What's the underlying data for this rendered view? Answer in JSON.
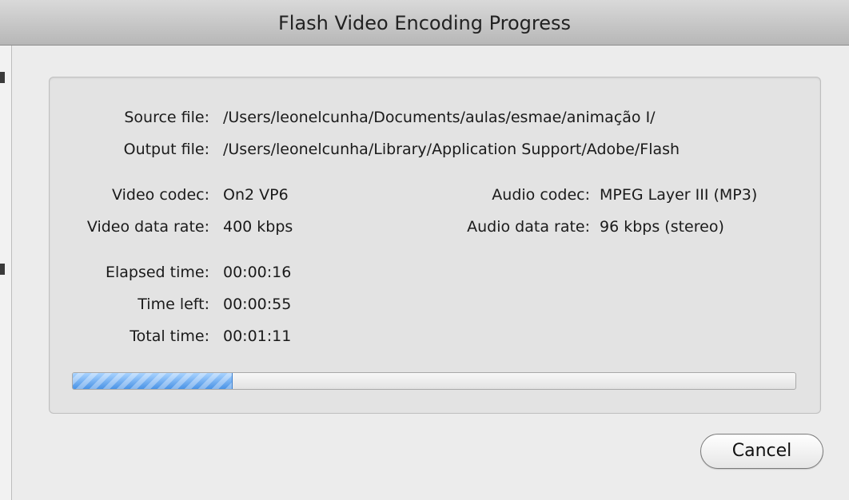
{
  "window": {
    "title": "Flash Video Encoding Progress"
  },
  "details": {
    "source_file": {
      "label": "Source file:",
      "value": "/Users/leonelcunha/Documents/aulas/esmae/animação I/"
    },
    "output_file": {
      "label": "Output file:",
      "value": "/Users/leonelcunha/Library/Application Support/Adobe/Flash"
    },
    "video_codec": {
      "label": "Video codec:",
      "value": "On2 VP6"
    },
    "video_data_rate": {
      "label": "Video data rate:",
      "value": "400 kbps"
    },
    "audio_codec": {
      "label": "Audio codec:",
      "value": "MPEG Layer III (MP3)"
    },
    "audio_data_rate": {
      "label": "Audio data rate:",
      "value": "96 kbps (stereo)"
    },
    "elapsed_time": {
      "label": "Elapsed time:",
      "value": "00:00:16"
    },
    "time_left": {
      "label": "Time left:",
      "value": "00:00:55"
    },
    "total_time": {
      "label": "Total time:",
      "value": "00:01:11"
    }
  },
  "progress": {
    "percent": 22
  },
  "buttons": {
    "cancel": "Cancel"
  },
  "colors": {
    "progress_fill": "#4a93e6",
    "window_background": "#ececec"
  }
}
